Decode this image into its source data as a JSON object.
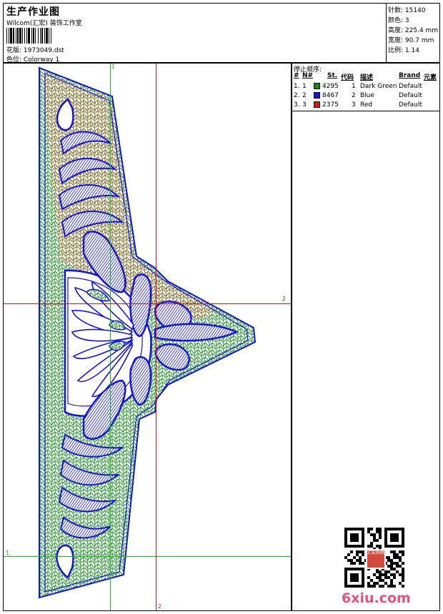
{
  "header": {
    "title": "生产作业图",
    "company": "Wilcom(汇宏) 装饰工作室",
    "pattern_label": "花版:",
    "pattern_value": "1973049.dst",
    "colorway_label": "色位:",
    "colorway_value": "Colorway 1"
  },
  "stats": {
    "stitches_label": "针数:",
    "stitches_value": "15140",
    "colors_label": "颜色:",
    "colors_value": "3",
    "height_label": "高度:",
    "height_value": "225.4 mm",
    "width_label": "宽度:",
    "width_value": "90.7 mm",
    "scale_label": "比例:",
    "scale_value": "1.14"
  },
  "sequence": {
    "title": "停止顺序:",
    "headers": [
      "#",
      "N#",
      "St.",
      "代码",
      "描述",
      "Brand",
      "元素"
    ],
    "rows": [
      {
        "index": "1.",
        "n": "1",
        "color": "#0a8a12",
        "st": "4295",
        "code": "1",
        "desc": "Dark Green",
        "brand": "Default"
      },
      {
        "index": "2.",
        "n": "2",
        "color": "#1414d8",
        "st": "8467",
        "code": "2",
        "desc": "Blue",
        "brand": "Default"
      },
      {
        "index": "3.",
        "n": "3",
        "color": "#d81414",
        "st": "2375",
        "code": "3",
        "desc": "Red",
        "brand": "Default"
      }
    ]
  },
  "crosshair": {
    "v1": "1",
    "h1": "1",
    "h2": "2",
    "v2": "2",
    "v1_color": "#10c010",
    "h1_color": "#10c010",
    "v2_color": "#d81414",
    "h2_color": "#d81414"
  },
  "watermark": {
    "text": "6xiu.com",
    "seal": "汇宏刺绣"
  }
}
